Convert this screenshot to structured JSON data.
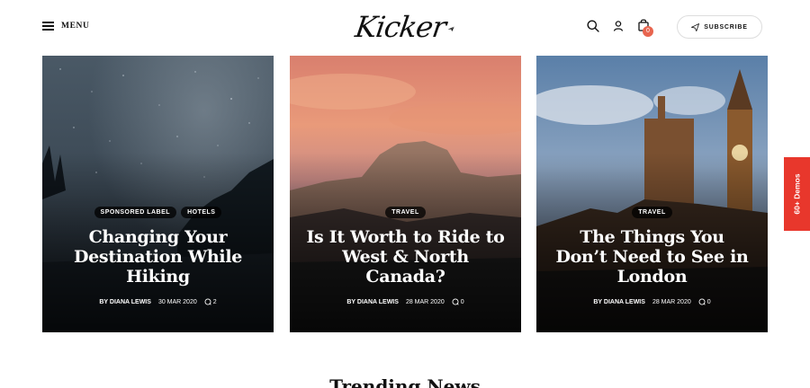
{
  "header": {
    "menu_label": "MENU",
    "logo_text": "Kicker",
    "subscribe_label": "SUBSCRIBE",
    "cart_count": "0"
  },
  "posts": [
    {
      "tags": [
        "SPONSORED LABEL",
        "HOTELS"
      ],
      "title": "Changing Your Destination While Hiking",
      "author_prefix": "BY",
      "author": "DIANA LEWIS",
      "date": "30 MAR 2020",
      "comments": "2"
    },
    {
      "tags": [
        "TRAVEL"
      ],
      "title": "Is It Worth to Ride to West & North Canada?",
      "author_prefix": "BY",
      "author": "DIANA LEWIS",
      "date": "28 MAR 2020",
      "comments": "0"
    },
    {
      "tags": [
        "TRAVEL"
      ],
      "title": "The Things You Don’t Need to See in London",
      "author_prefix": "BY",
      "author": "DIANA LEWIS",
      "date": "28 MAR 2020",
      "comments": "0"
    }
  ],
  "demos_tab_label": "60+ Demos",
  "section_heading": "Trending News",
  "colors": {
    "accent": "#e8654f",
    "demos_tab": "#e8372c",
    "text": "#111111"
  }
}
